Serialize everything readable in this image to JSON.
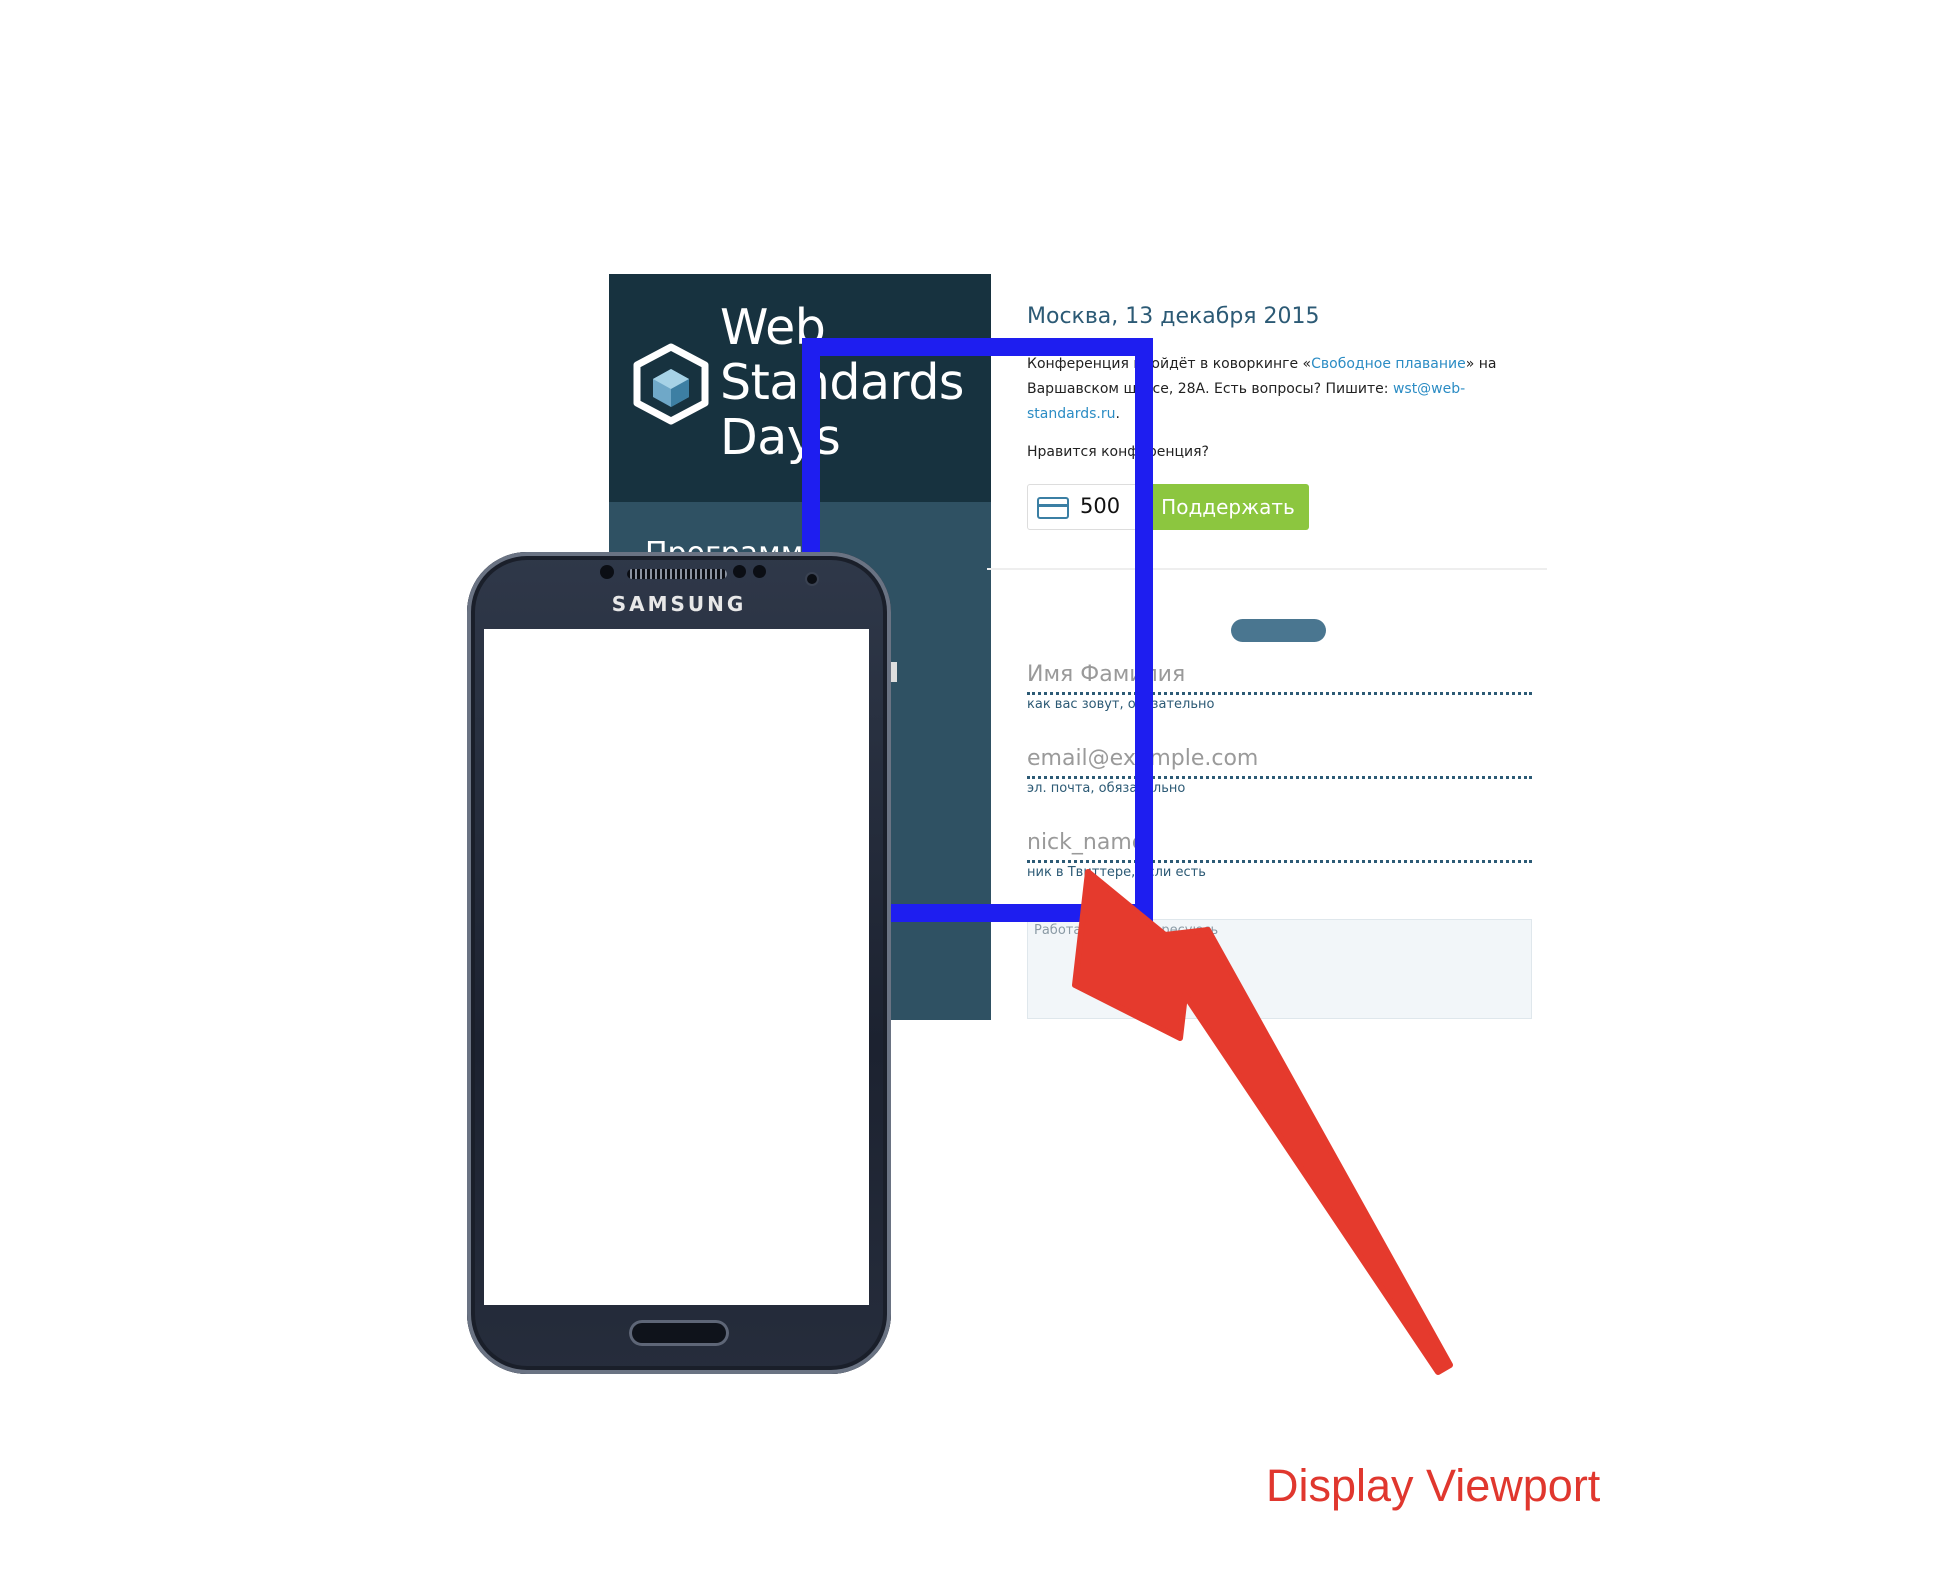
{
  "website": {
    "logo_lines": [
      "Web",
      "Standards",
      "Days"
    ],
    "side_nav_partial": "Программа",
    "city_date": "Москва, 13 декабря 2015",
    "intro": {
      "part1": "Конференция пройдёт в коворкинге «",
      "venue_link": "Свободное плавание",
      "part2": "» на Варшавском шоссе, 28А. Есть вопросы? Пишите: ",
      "email_link": "wst@web-standards.ru",
      "part3": "."
    },
    "like_question": "Нравится конференция?",
    "donation_amount": "500",
    "support_button": "Поддержать",
    "form": {
      "name_placeholder": "Имя Фамилия",
      "name_hint": "как вас зовут, обязательно",
      "email_placeholder": "email@example.com",
      "email_hint": "эл. почта, обязательно",
      "nick_placeholder": "nick_name",
      "nick_hint": "ник в Твиттере, если есть",
      "about_placeholder": "Работаю в ..., интересуюсь"
    }
  },
  "phone": {
    "brand": "SAMSUNG"
  },
  "annotation": {
    "label": "Display Viewport",
    "color": "#e0372e"
  },
  "colors": {
    "viewport_frame": "#1e1ef0",
    "sidebar": "#2f5163",
    "logo_bg": "#17323f",
    "support_button": "#8cc63f",
    "link": "#2b8cc4"
  }
}
